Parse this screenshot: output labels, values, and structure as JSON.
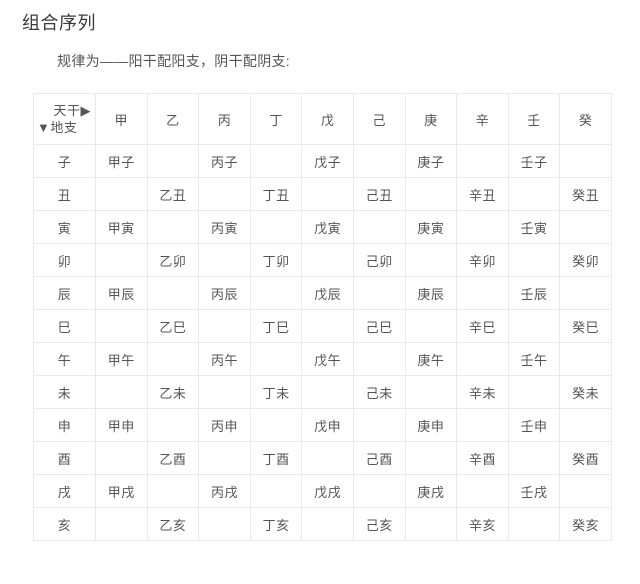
{
  "page": {
    "title": "组合序列",
    "subtitle": "规律为——阳干配阳支，阴干配阴支:"
  },
  "table": {
    "corner": {
      "top_label": "天干",
      "top_arrow": "▶",
      "bottom_arrow": "▼",
      "bottom_label": "地支"
    },
    "heavenly_stems": [
      "甲",
      "乙",
      "丙",
      "丁",
      "戊",
      "己",
      "庚",
      "辛",
      "壬",
      "癸"
    ],
    "earthly_branches": [
      "子",
      "丑",
      "寅",
      "卯",
      "辰",
      "巳",
      "午",
      "未",
      "申",
      "酉",
      "戌",
      "亥"
    ],
    "rows": [
      {
        "branch": "子",
        "cells": [
          "甲子",
          "",
          "丙子",
          "",
          "戊子",
          "",
          "庚子",
          "",
          "壬子",
          ""
        ]
      },
      {
        "branch": "丑",
        "cells": [
          "",
          "乙丑",
          "",
          "丁丑",
          "",
          "己丑",
          "",
          "辛丑",
          "",
          "癸丑"
        ]
      },
      {
        "branch": "寅",
        "cells": [
          "甲寅",
          "",
          "丙寅",
          "",
          "戊寅",
          "",
          "庚寅",
          "",
          "壬寅",
          ""
        ]
      },
      {
        "branch": "卯",
        "cells": [
          "",
          "乙卯",
          "",
          "丁卯",
          "",
          "己卯",
          "",
          "辛卯",
          "",
          "癸卯"
        ]
      },
      {
        "branch": "辰",
        "cells": [
          "甲辰",
          "",
          "丙辰",
          "",
          "戊辰",
          "",
          "庚辰",
          "",
          "壬辰",
          ""
        ]
      },
      {
        "branch": "巳",
        "cells": [
          "",
          "乙巳",
          "",
          "丁巳",
          "",
          "己巳",
          "",
          "辛巳",
          "",
          "癸巳"
        ]
      },
      {
        "branch": "午",
        "cells": [
          "甲午",
          "",
          "丙午",
          "",
          "戊午",
          "",
          "庚午",
          "",
          "壬午",
          ""
        ]
      },
      {
        "branch": "未",
        "cells": [
          "",
          "乙未",
          "",
          "丁未",
          "",
          "己未",
          "",
          "辛未",
          "",
          "癸未"
        ]
      },
      {
        "branch": "申",
        "cells": [
          "甲申",
          "",
          "丙申",
          "",
          "戊申",
          "",
          "庚申",
          "",
          "壬申",
          ""
        ]
      },
      {
        "branch": "酉",
        "cells": [
          "",
          "乙酉",
          "",
          "丁酉",
          "",
          "己酉",
          "",
          "辛酉",
          "",
          "癸酉"
        ]
      },
      {
        "branch": "戌",
        "cells": [
          "甲戌",
          "",
          "丙戌",
          "",
          "戊戌",
          "",
          "庚戌",
          "",
          "壬戌",
          ""
        ]
      },
      {
        "branch": "亥",
        "cells": [
          "",
          "乙亥",
          "",
          "丁亥",
          "",
          "己亥",
          "",
          "辛亥",
          "",
          "癸亥"
        ]
      }
    ]
  },
  "colors": {
    "background": "#ffffff",
    "title_text": "#3a3a3a",
    "body_text": "#555555",
    "grid_line": "#e9e9e9"
  }
}
